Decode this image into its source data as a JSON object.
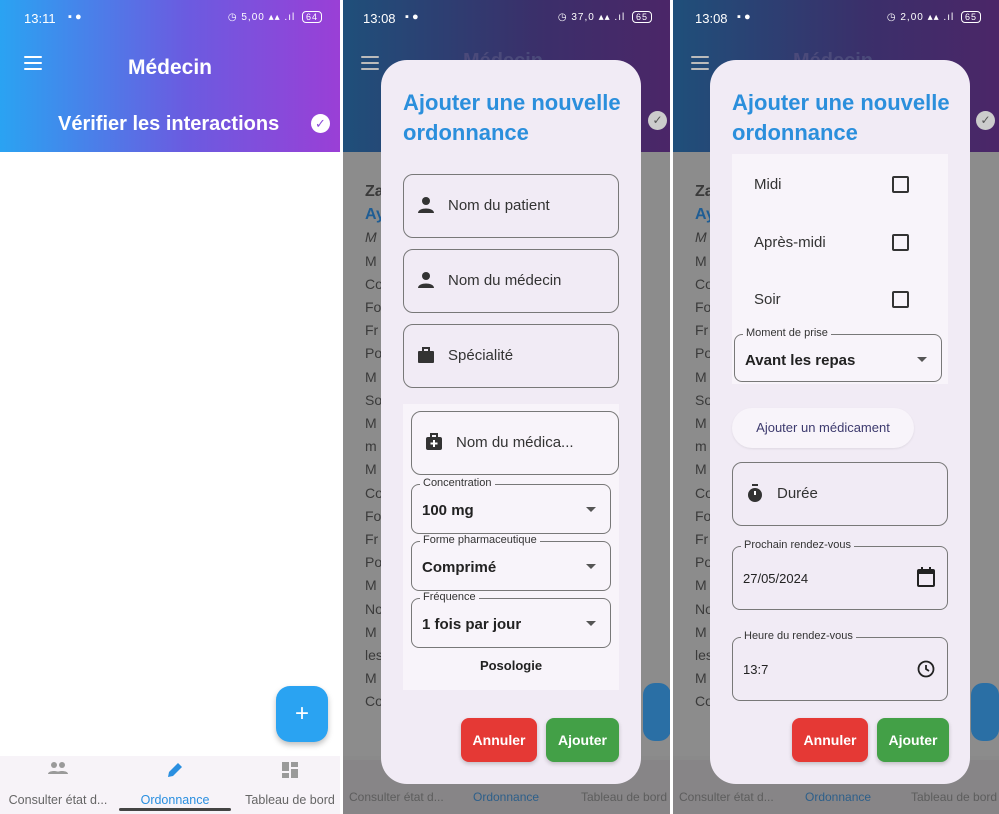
{
  "screens": [
    {
      "status": {
        "time": "13:11",
        "net": "5,00",
        "battery": "64"
      },
      "app_title": "Médecin",
      "verify_label": "Vérifier les interactions",
      "fab": "+",
      "nav": [
        "Consulter état d...",
        "Ordonnance",
        "Tableau de bord"
      ]
    },
    {
      "status": {
        "time": "13:08",
        "net": "37,0",
        "battery": "65"
      },
      "background_title": "Médecin",
      "background_letters": [
        "Za",
        "Ay",
        "M",
        "M",
        "Co",
        "Fo",
        "Fr",
        "Po",
        "M",
        "So",
        "M",
        "m",
        "M",
        "Co",
        "Fo",
        "Fr",
        "Po",
        "M",
        "No",
        "M",
        "les",
        "M",
        "Co"
      ],
      "dialog": {
        "title": "Ajouter une nouvelle ordonnance",
        "fields": [
          "Nom du patient",
          "Nom du médecin",
          "Spécialité"
        ],
        "medication_field": "Nom du médica...",
        "dropdowns": [
          {
            "label": "Concentration",
            "value": "100 mg"
          },
          {
            "label": "Forme pharmaceutique",
            "value": "Comprimé"
          },
          {
            "label": "Fréquence",
            "value": "1 fois par jour"
          }
        ],
        "posology_label": "Posologie",
        "cancel": "Annuler",
        "add": "Ajouter"
      },
      "nav": [
        "Consulter état d...",
        "Ordonnance",
        "Tableau de bord"
      ]
    },
    {
      "status": {
        "time": "13:08",
        "net": "2,00",
        "battery": "65"
      },
      "background_title": "Médecin",
      "background_letters": [
        "Za",
        "Ay",
        "M",
        "M",
        "Co",
        "Fo",
        "Fr",
        "Po",
        "M",
        "So",
        "M",
        "m",
        "M",
        "Co",
        "Fo",
        "Fr",
        "Po",
        "M",
        "No",
        "M",
        "les",
        "M",
        "Co"
      ],
      "dialog": {
        "title": "Ajouter une nouvelle ordonnance",
        "checkboxes": [
          "Midi",
          "Après-midi",
          "Soir"
        ],
        "moment": {
          "label": "Moment de prise",
          "value": "Avant les repas"
        },
        "add_med": "Ajouter un médicament",
        "duration": "Durée",
        "next_rdv": {
          "label": "Prochain rendez-vous",
          "value": "27/05/2024"
        },
        "rdv_time": {
          "label": "Heure du rendez-vous",
          "value": "13:7"
        },
        "cancel": "Annuler",
        "add": "Ajouter"
      },
      "nav": [
        "Consulter état d...",
        "Ordonnance",
        "Tableau de bord"
      ]
    }
  ],
  "colors": {
    "accent_blue": "#2aa3f2",
    "accent_purple": "#9a3fd6",
    "title_blue": "#2b8fdc",
    "cancel_red": "#e53935",
    "add_green": "#43a047"
  },
  "icons": [
    "menu-icon",
    "check-circle-icon",
    "person-icon",
    "briefcase-icon",
    "medical-bag-icon",
    "stopwatch-icon",
    "calendar-icon",
    "clock-icon",
    "people-icon",
    "edit-icon",
    "dashboard-icon"
  ]
}
